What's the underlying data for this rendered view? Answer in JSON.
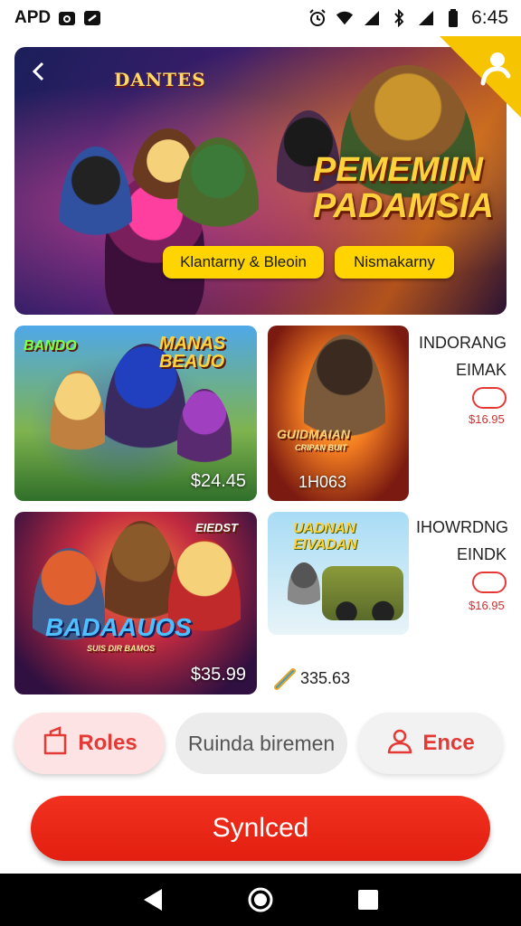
{
  "status_bar": {
    "carrier": "APD",
    "time": "6:45",
    "icons": [
      "camera-icon",
      "link-icon",
      "alarm-icon",
      "wifi-icon",
      "signal-icon",
      "bluetooth-icon",
      "signal-icon",
      "battery-icon"
    ]
  },
  "hero": {
    "logo_text": "DANTES",
    "title": "PEMEMIIN PADAMSIA",
    "chip_left": "Klantarny & Bleoin",
    "chip_right": "Nismakarny",
    "back_icon": "back-arrow-icon",
    "badge_icon": "user-icon"
  },
  "cards": [
    {
      "label_left": "BANDO",
      "label_right": "MANAS BEAUO",
      "price": "$24.45"
    },
    {
      "label": "GUIDMAIAN",
      "sub": "CRIPAN BUIT",
      "price": "1H063"
    },
    {
      "label_corner": "EIEDST",
      "label": "BADAAUOS",
      "sub": "SUIS DIR BAMOS",
      "price": "$35.99"
    },
    {
      "label": "UADNAN EIVADAN",
      "price": "335.63"
    }
  ],
  "side_info": [
    {
      "line1": "INDORANG",
      "line2": "EIMAK",
      "price": "$16.95"
    },
    {
      "line1": "IHOWRDNG",
      "line2": "EINDK",
      "price": "$16.95"
    }
  ],
  "actions": {
    "roles_label": "Roles",
    "search_label": "Ruinda biremen",
    "ence_label": "Ence",
    "primary_label": "Synlced"
  },
  "colors": {
    "accent": "#e53935",
    "primary_button": "#e62515",
    "chip": "#ffd400",
    "badge": "#f6c400"
  }
}
